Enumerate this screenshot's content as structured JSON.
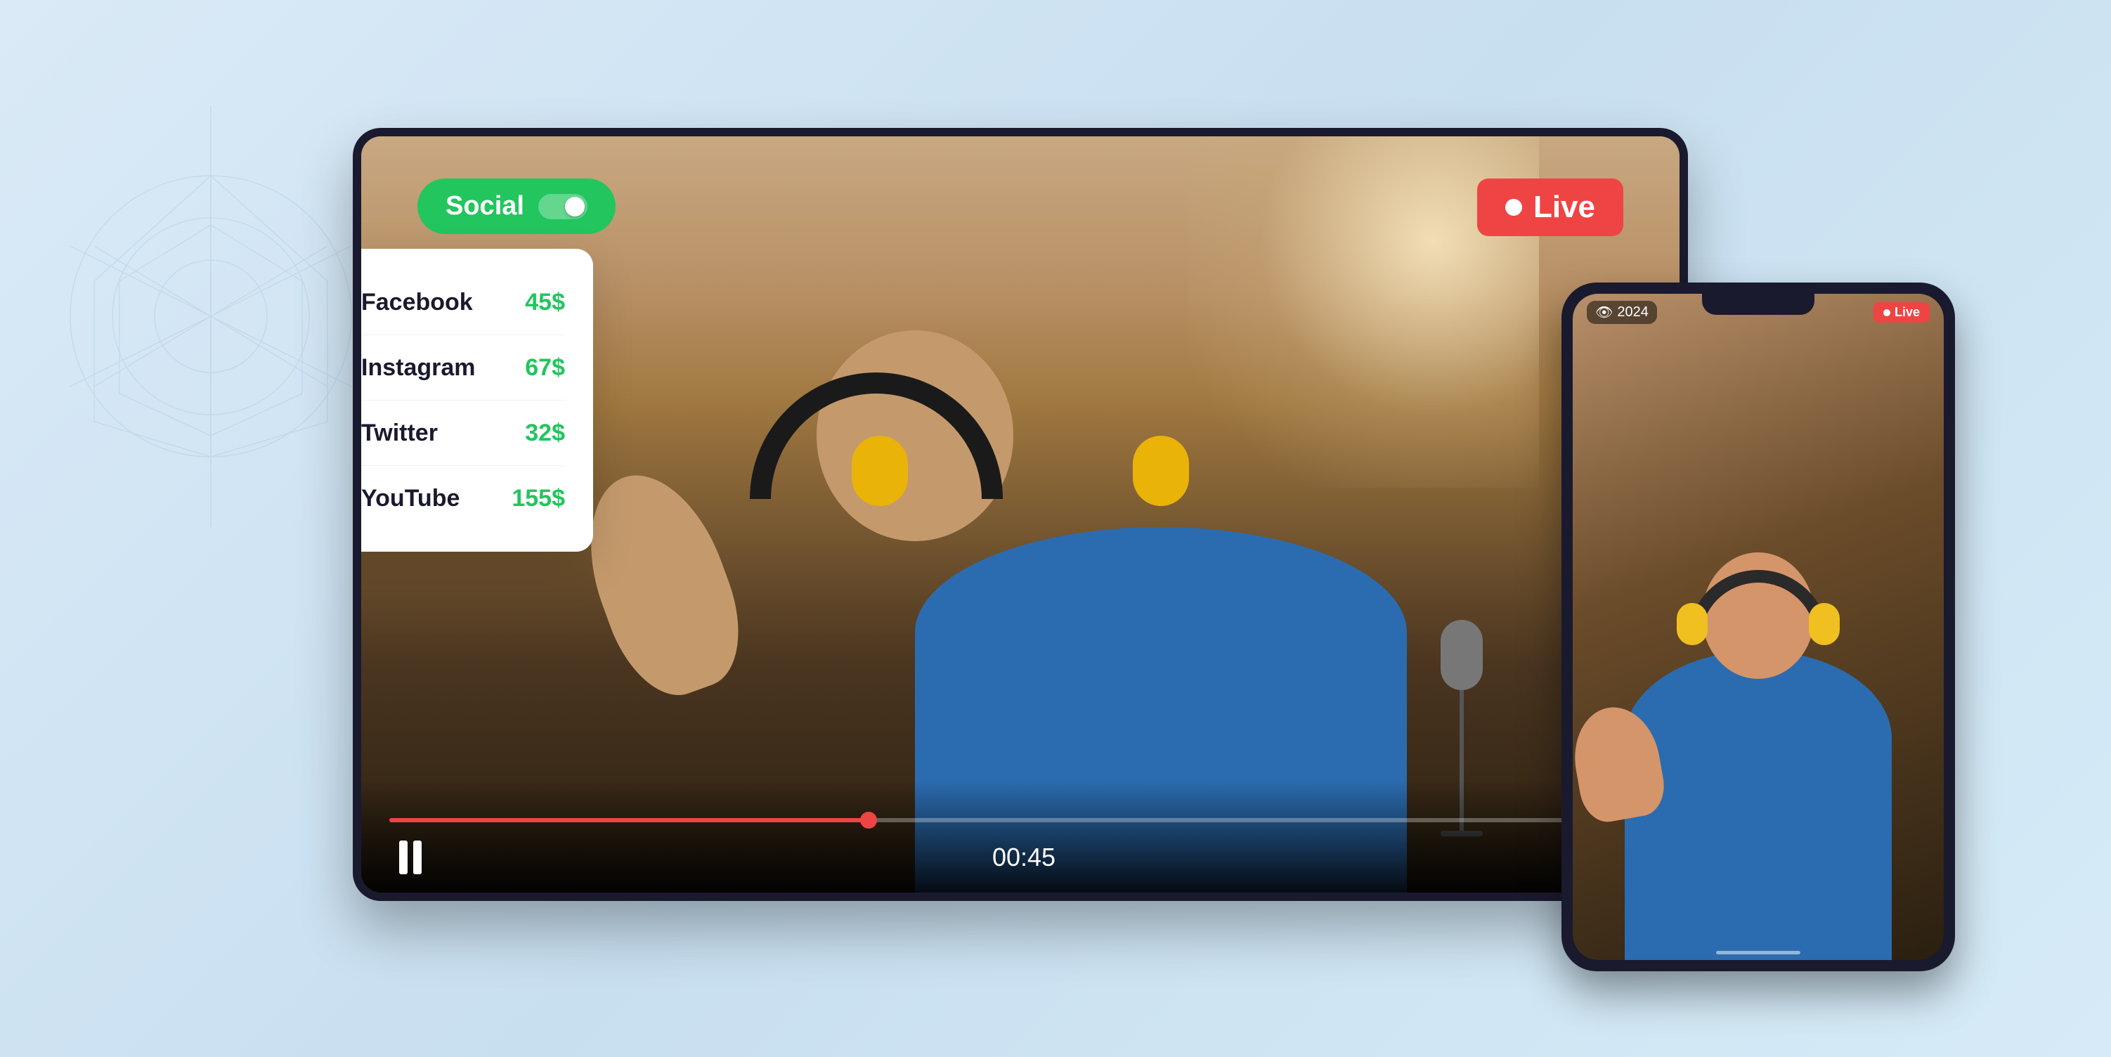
{
  "background": {
    "color_start": "#daeaf7",
    "color_end": "#c8dff0"
  },
  "social_toggle": {
    "label": "Social",
    "state": "on",
    "color": "#22c55e"
  },
  "live_badge": {
    "label": "Live",
    "color": "#ef4444"
  },
  "social_card": {
    "items": [
      {
        "platform": "Facebook",
        "amount": "45$",
        "icon_type": "facebook",
        "amount_color": "#22c55e"
      },
      {
        "platform": "Instagram",
        "amount": "67$",
        "icon_type": "instagram",
        "amount_color": "#22c55e"
      },
      {
        "platform": "Twitter",
        "amount": "32$",
        "icon_type": "twitter",
        "amount_color": "#22c55e"
      },
      {
        "platform": "YouTube",
        "amount": "155$",
        "icon_type": "youtube",
        "amount_color": "#22c55e"
      }
    ]
  },
  "video_player": {
    "timestamp": "00:45",
    "progress_percent": 38,
    "accent_color": "#ef4444"
  },
  "phone": {
    "year": "2024",
    "live_label": "Live"
  }
}
